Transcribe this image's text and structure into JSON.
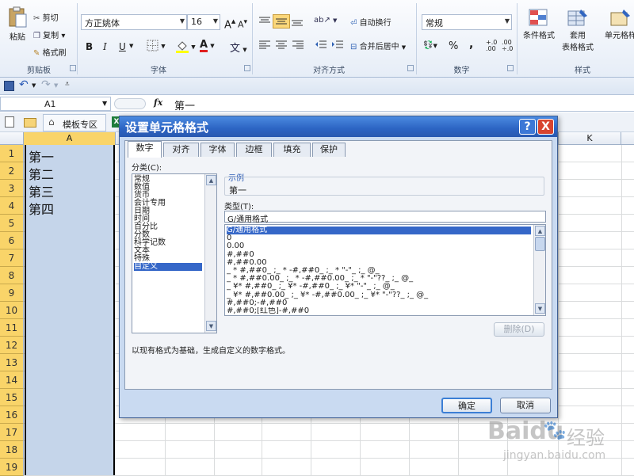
{
  "ribbon": {
    "clipboard": {
      "paste": "粘贴",
      "cut": "剪切",
      "copy": "复制",
      "format_painter": "格式刷",
      "label": "剪贴板"
    },
    "font": {
      "font_name": "方正姚体",
      "font_size": "16",
      "grow": "A",
      "shrink": "A",
      "bold": "B",
      "italic": "I",
      "underline": "U",
      "font_color_letter": "A",
      "phonetic": "文",
      "label": "字体"
    },
    "alignment": {
      "wrap_text": "自动换行",
      "merge_center": "合并后居中",
      "label": "对齐方式"
    },
    "number": {
      "format": "常规",
      "percent": "%",
      "comma": ",",
      "inc_decimal": "+.0 .00",
      "dec_decimal": ".00 ÷.0",
      "label": "数字"
    },
    "styles": {
      "conditional": "条件格式",
      "table_1": "套用",
      "table_2": "表格格式",
      "cell_styles": "单元格样",
      "label": "样式"
    }
  },
  "formula_bar": {
    "name_box": "A1",
    "fx": "fx",
    "value": "第一"
  },
  "tabs": {
    "template": "模板专区",
    "x_icon": "X"
  },
  "columns": {
    "A": "A",
    "K": "K"
  },
  "rows": [
    "1",
    "2",
    "3",
    "4",
    "5",
    "6",
    "7",
    "8",
    "9",
    "10",
    "11",
    "12",
    "13",
    "14",
    "15",
    "16",
    "17",
    "18",
    "19"
  ],
  "cells_A": [
    "第一",
    "第二",
    "第三",
    "第四"
  ],
  "dialog": {
    "title": "设置单元格格式",
    "help": "?",
    "close": "X",
    "tabs": [
      "数字",
      "对齐",
      "字体",
      "边框",
      "填充",
      "保护"
    ],
    "category_label": "分类(C):",
    "categories": [
      "常规",
      "数值",
      "货币",
      "会计专用",
      "日期",
      "时间",
      "百分比",
      "分数",
      "科学记数",
      "文本",
      "特殊",
      "自定义"
    ],
    "sample_label": "示例",
    "sample_value": "第一",
    "type_label": "类型(T):",
    "type_value": "G/通用格式",
    "formats": [
      "G/通用格式",
      "0",
      "0.00",
      "#,##0",
      "#,##0.00",
      "_ * #,##0_ ;_ * -#,##0_ ;_ * \"-\"_ ;_ @_",
      "_ * #,##0.00_ ;_ * -#,##0.00_ ;_ * \"-\"??_ ;_ @_",
      "_ ¥* #,##0_ ;_ ¥* -#,##0_ ;_ ¥* \"-\"_ ;_ @_",
      "_ ¥* #,##0.00_ ;_ ¥* -#,##0.00_ ;_ ¥* \"-\"??_ ;_ @_",
      "#,##0;-#,##0",
      "#,##0;[红色]-#,##0"
    ],
    "delete_button": "删除(D)",
    "description": "以现有格式为基础，生成自定义的数字格式。",
    "ok": "确定",
    "cancel": "取消"
  },
  "watermark": {
    "brand": "Baidu",
    "jingyan": "经验",
    "url": "jingyan.baidu.com"
  }
}
